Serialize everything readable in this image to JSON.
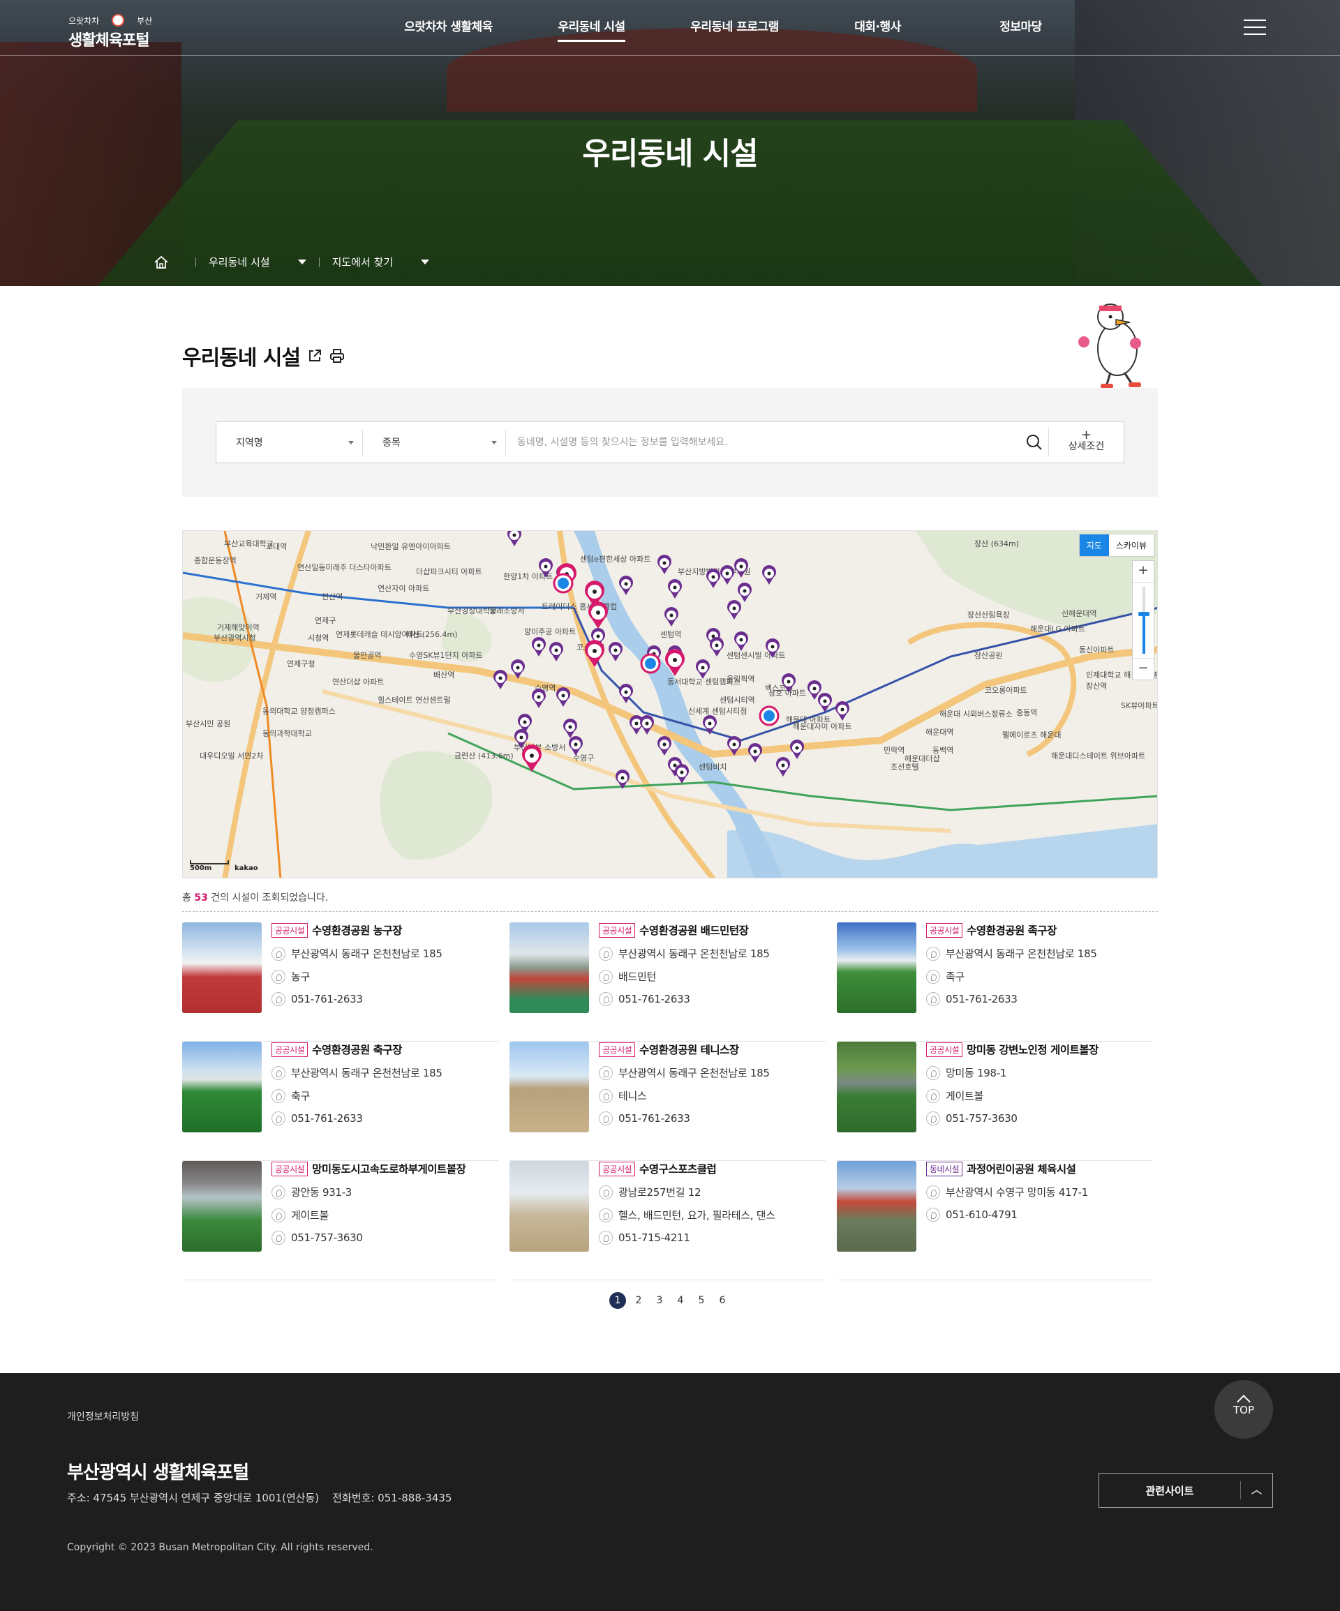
{
  "header": {
    "logo_top_left": "으랏차차",
    "logo_top_right": "부산",
    "logo_main": "생활체육포털",
    "menu": [
      {
        "label": "으랏차차 생활체육",
        "active": false
      },
      {
        "label": "우리동네 시설",
        "active": true
      },
      {
        "label": "우리동네 프로그램",
        "active": false
      },
      {
        "label": "대회·행사",
        "active": false
      },
      {
        "label": "정보마당",
        "active": false
      }
    ]
  },
  "hero": {
    "title": "우리동네 시설",
    "breadcrumb": [
      "우리동네 시설",
      "지도에서 찾기"
    ]
  },
  "page": {
    "title": "우리동네 시설"
  },
  "search": {
    "region_label": "지역명",
    "sport_label": "종목",
    "placeholder": "동네명, 시설명 등의 찾으시는 정보를 입력해보세요.",
    "detail_label": "상세조건"
  },
  "map": {
    "type_map": "지도",
    "type_sky": "스카이뷰",
    "scale": "500m",
    "provider": "kakao",
    "labels": [
      "부산교육대학교",
      "교대역",
      "낙민환일 유엔아이아파트",
      "종합운동장역",
      "연산일동미래주 더스타아파트",
      "더샵파크시티 아파트",
      "한양1차 아파트",
      "센텀e편한세상 아파트",
      "부산지방법원 동부지원",
      "장산 (634m)",
      "거제역",
      "연산역",
      "연산자이 아파트",
      "부산경상대학교",
      "동래소방서",
      "트레이더스 홈세일 클럽",
      "장산산림욕장",
      "신해운대역",
      "연제구",
      "배산 (256.4m)",
      "센텀역",
      "해운대LG 아파트",
      "거제해맞이역",
      "부산광역시청",
      "시청역",
      "연제롯데캐슬 데시앙아파트",
      "망미주공 아파트",
      "코스트코",
      "센텀센시빌 아파트",
      "장산공원",
      "동신아파트",
      "물만골역",
      "수영SK뷰1단지 아파트",
      "연제구청",
      "배산역",
      "동서대학교 센텀캠퍼스",
      "올림픽역",
      "인제대학교 해운대백병원",
      "연산더샵 아파트",
      "수영역",
      "벡스코역",
      "코오롱아파트",
      "장산역",
      "힐스테이트 연산센트럴",
      "센텀시티역",
      "삼호 아파트",
      "SK뷰아파트",
      "동의대학교 양정캠퍼스",
      "부산시민 공원",
      "해운대 시외버스정류소",
      "중동역",
      "해운대 아파트",
      "신세계 센텀시티점",
      "해운대역",
      "해운대자이 아파트",
      "동의과학대학교",
      "수영구",
      "부산남부 소방서",
      "민락역",
      "펠에이로츠 해운대",
      "대우디오빌 서면2차",
      "금련산 (413.6m)",
      "센텀비치",
      "해운대디스테이트 위브아파트",
      "동백역",
      "해운대더샵",
      "조선호텔"
    ]
  },
  "result": {
    "count_prefix": "총",
    "count": "53",
    "count_suffix": "건의 시설이 조회되었습니다."
  },
  "facilities": [
    {
      "badge": "공공시설",
      "name": "수영환경공원 농구장",
      "address": "부산광역시 동래구 온천천남로 185",
      "sport": "농구",
      "phone": "051-761-2633",
      "thumb": "basketball"
    },
    {
      "badge": "공공시설",
      "name": "수영환경공원 배드민턴장",
      "address": "부산광역시 동래구 온천천남로 185",
      "sport": "배드민턴",
      "phone": "051-761-2633",
      "thumb": "badminton"
    },
    {
      "badge": "공공시설",
      "name": "수영환경공원 족구장",
      "address": "부산광역시 동래구 온천천남로 185",
      "sport": "족구",
      "phone": "051-761-2633",
      "thumb": "jokgu"
    },
    {
      "badge": "공공시설",
      "name": "수영환경공원 축구장",
      "address": "부산광역시 동래구 온천천남로 185",
      "sport": "축구",
      "phone": "051-761-2633",
      "thumb": "soccer"
    },
    {
      "badge": "공공시설",
      "name": "수영환경공원 테니스장",
      "address": "부산광역시 동래구 온천천남로 185",
      "sport": "테니스",
      "phone": "051-761-2633",
      "thumb": "tennis"
    },
    {
      "badge": "공공시설",
      "name": "망미동 강변노인정 게이트볼장",
      "address": "망미동 198-1",
      "sport": "게이트볼",
      "phone": "051-757-3630",
      "thumb": "gate"
    },
    {
      "badge": "공공시설",
      "name": "망미동도시고속도로하부게이트볼장",
      "address": "광안동 931-3",
      "sport": "게이트볼",
      "phone": "051-757-3630",
      "thumb": "under"
    },
    {
      "badge": "공공시설",
      "name": "수영구스포츠클럽",
      "address": "광남로257번길 12",
      "sport": "헬스, 배드민턴, 요가, 필라테스, 댄스",
      "phone": "051-715-4211",
      "thumb": "gym"
    },
    {
      "badge": "동네시설",
      "name": "과정어린이공원 체육시설",
      "address": "부산광역시 수영구 망미동 417-1",
      "sport": "",
      "phone": "051-610-4791",
      "thumb": "park"
    }
  ],
  "pagination": [
    "1",
    "2",
    "3",
    "4",
    "5",
    "6"
  ],
  "footer": {
    "privacy": "개인정보처리방침",
    "org": "부산광역시 생활체육포털",
    "address": "주소: 47545 부산광역시 연제구 중앙대로 1001(연산동)    전화번호: 051-888-3435",
    "copyright": "Copyright © 2023 Busan Metropolitan City. All rights reserved.",
    "related": "관련사이트",
    "top": "TOP"
  },
  "colors": {
    "accent_pink": "#d6196b",
    "accent_purple": "#6b2e8f",
    "page_navy": "#1f2f56",
    "map_blue": "#1a86e6"
  }
}
